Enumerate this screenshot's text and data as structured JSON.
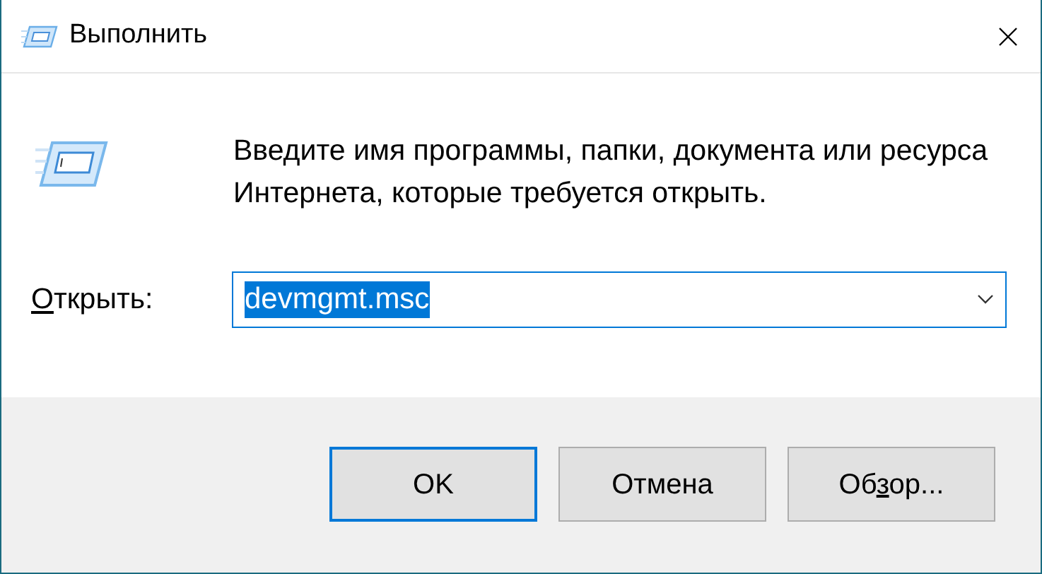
{
  "window": {
    "title": "Выполнить"
  },
  "description": "Введите имя программы, папки, документа или ресурса Интернета, которые требуется открыть.",
  "open_field": {
    "label": {
      "key": "О",
      "post": "ткрыть:"
    },
    "value": "devmgmt.msc",
    "text_selected": true
  },
  "buttons": [
    {
      "label": {
        "pre": "OK"
      },
      "default": true
    },
    {
      "label": {
        "pre": "Отмена"
      },
      "default": false
    },
    {
      "label": {
        "pre": "Об",
        "key": "з",
        "post": "ор..."
      },
      "default": false
    }
  ]
}
